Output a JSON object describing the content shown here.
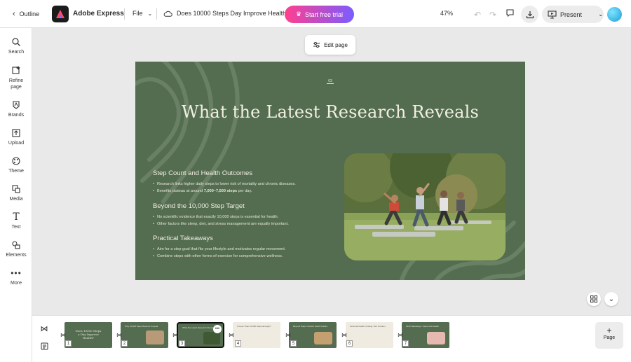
{
  "topbar": {
    "outline_label": "Outline",
    "brand": "Adobe Express",
    "file_label": "File",
    "doc_title": "Does 10000 Steps Day Improve Health",
    "trial_label": "Start free trial",
    "zoom": "47%",
    "present_label": "Present"
  },
  "rail": {
    "items": [
      {
        "label": "Search",
        "icon": "search-icon"
      },
      {
        "label": "Refine page",
        "icon": "refine-icon"
      },
      {
        "label": "Brands",
        "icon": "brands-icon"
      },
      {
        "label": "Upload",
        "icon": "upload-icon"
      },
      {
        "label": "Theme",
        "icon": "theme-icon"
      },
      {
        "label": "Media",
        "icon": "media-icon"
      },
      {
        "label": "Text",
        "icon": "text-icon"
      },
      {
        "label": "Elements",
        "icon": "elements-icon"
      },
      {
        "label": "More",
        "icon": "more-icon"
      }
    ]
  },
  "canvas": {
    "edit_page_label": "Edit page"
  },
  "slide": {
    "number": "03",
    "title": "What the Latest Research Reveals",
    "sections": [
      {
        "heading": "Step Count and Health Outcomes",
        "bullets": [
          "Research links higher daily steps to lower risk of mortality and chronic diseases.",
          "Benefits plateau at around 7,000–7,500 steps per day."
        ]
      },
      {
        "heading": "Beyond the 10,000 Step Target",
        "bullets": [
          "No scientific evidence that exactly 10,000 steps is essential for health.",
          "Other factors like sleep, diet, and stress management are equally important."
        ]
      },
      {
        "heading": "Practical Takeaways",
        "bullets": [
          "Aim for a step goal that fits your lifestyle and motivates regular movement.",
          "Combine steps with other forms of exercise for comprehensive wellness."
        ]
      }
    ]
  },
  "pages": {
    "thumbs": [
      {
        "num": "1",
        "title": "Does 10000 Steps a Day Improve Health?",
        "theme": "green"
      },
      {
        "num": "2",
        "title": "Why 10,000 Steps Became Popular",
        "theme": "green"
      },
      {
        "num": "3",
        "title": "What the Latest Research Reveals",
        "theme": "green"
      },
      {
        "num": "4",
        "title": "Is Less Than 10,000 Steps Enough?",
        "theme": "beige"
      },
      {
        "num": "5",
        "title": "Beyond Steps: Holistic Health Habits",
        "theme": "green"
      },
      {
        "num": "6",
        "title": "Personal health: Finding Your Number",
        "theme": "beige"
      },
      {
        "num": "7",
        "title": "Final Takeaways: Steps and Health",
        "theme": "green"
      }
    ],
    "add_label": "Page"
  },
  "colors": {
    "slide_bg": "#546d50",
    "accent_gradient_start": "#ff3f8f",
    "accent_gradient_end": "#7b5cff"
  }
}
